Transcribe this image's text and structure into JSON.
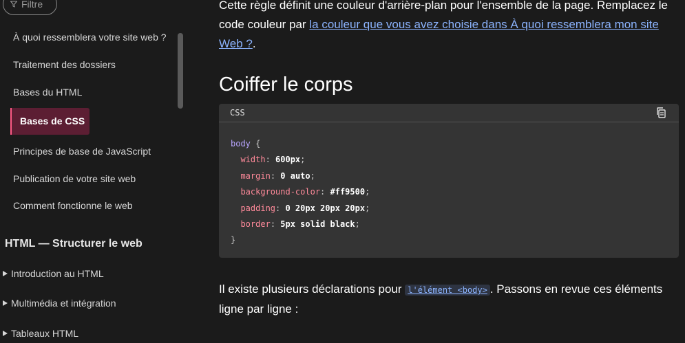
{
  "sidebar": {
    "filter_placeholder": "Filtre",
    "items": [
      {
        "label": "À quoi ressemblera votre site web ?"
      },
      {
        "label": "Traitement des dossiers"
      },
      {
        "label": "Bases du HTML"
      },
      {
        "label": "Bases de CSS"
      },
      {
        "label": "Principes de base de JavaScript"
      },
      {
        "label": "Publication de votre site web"
      },
      {
        "label": "Comment fonctionne le web"
      }
    ],
    "section_title": "HTML — Structurer le web",
    "sub_items": [
      {
        "label": "Introduction au HTML"
      },
      {
        "label": "Multimédia et intégration"
      },
      {
        "label": "Tableaux HTML"
      }
    ]
  },
  "main": {
    "intro_text_1": "Cette règle définit une couleur d'arrière-plan pour l'ensemble de la page. Remplacez le code couleur par ",
    "intro_link": "la couleur que vous avez choisie dans À quoi ressemblera mon site Web ?",
    "intro_text_2": ".",
    "heading": "Coiffer le corps",
    "code_lang": "CSS",
    "code": {
      "selector": "body",
      "open": " {",
      "declarations": [
        {
          "prop": "width",
          "value": "600px"
        },
        {
          "prop": "margin",
          "value": "0 auto"
        },
        {
          "prop": "background-color",
          "value": "#ff9500"
        },
        {
          "prop": "padding",
          "value": "0 20px 20px 20px"
        },
        {
          "prop": "border",
          "value": "5px solid black"
        }
      ],
      "close": "}"
    },
    "outro_text_1": "Il existe plusieurs déclarations pour ",
    "outro_code_link": "l'élément <body>",
    "outro_text_2": ". Passons en revue ces éléments ligne par ligne :"
  },
  "colors": {
    "background": "#1b1b1b",
    "active_item_bg": "#5c1e33",
    "active_item_border": "#ff5a86",
    "link": "#8cb4ff",
    "code_bg": "#343434"
  }
}
